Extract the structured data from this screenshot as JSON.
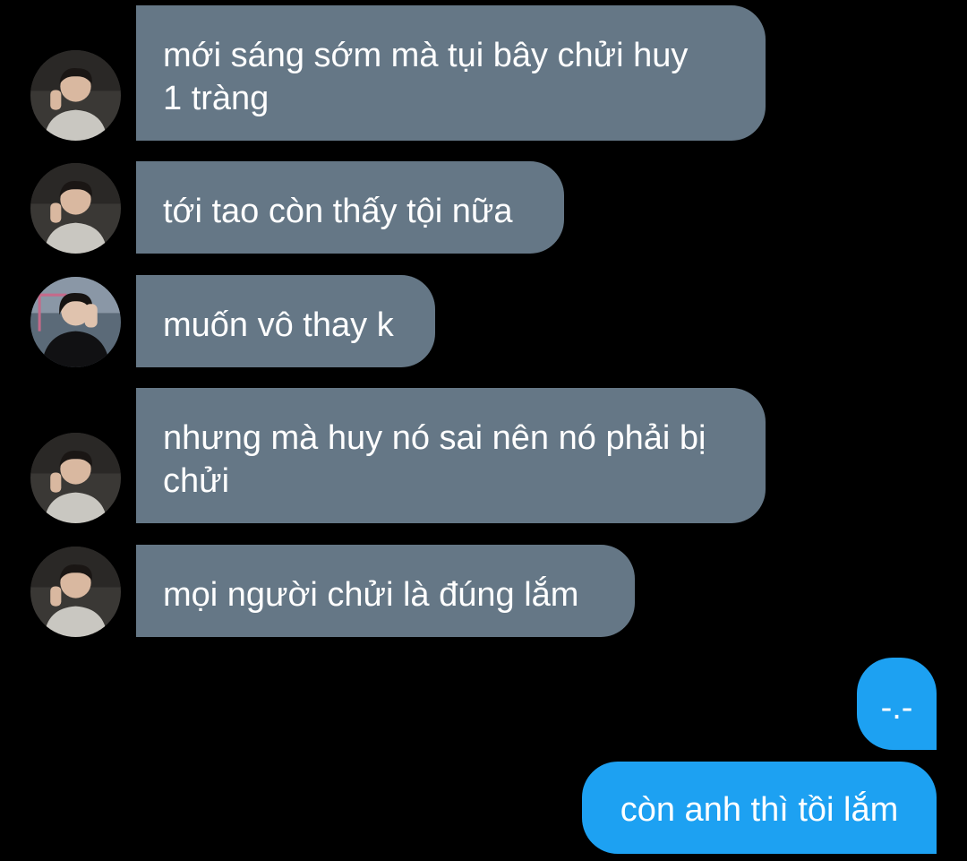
{
  "colors": {
    "background": "#000000",
    "incoming_bubble": "#657786",
    "outgoing_bubble": "#1DA1F2",
    "text": "#FFFFFF"
  },
  "messages": [
    {
      "direction": "incoming",
      "sender": "user-a",
      "text": "mới sáng sớm mà tụi bây chửi huy\n1 tràng"
    },
    {
      "direction": "incoming",
      "sender": "user-a",
      "text": "tới tao còn thấy tội nữa"
    },
    {
      "direction": "incoming",
      "sender": "user-b",
      "text": "muốn vô thay k"
    },
    {
      "direction": "incoming",
      "sender": "user-a",
      "text": "nhưng mà huy nó sai nên nó phải bị\nchửi"
    },
    {
      "direction": "incoming",
      "sender": "user-a",
      "text": "mọi người chửi là đúng lắm"
    },
    {
      "direction": "outgoing",
      "sender": "me",
      "text": "-.-"
    },
    {
      "direction": "outgoing",
      "sender": "me",
      "text": "còn anh thì tồi lắm"
    }
  ]
}
